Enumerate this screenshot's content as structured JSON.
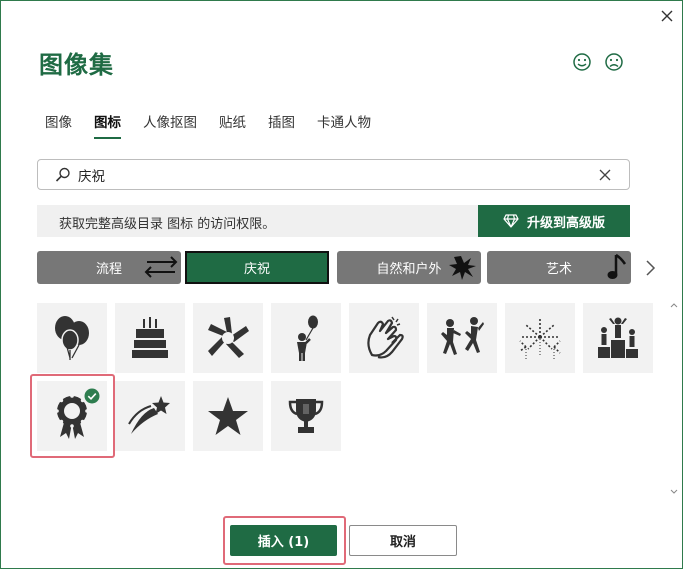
{
  "dialog": {
    "title": "图像集",
    "close_icon": "close-icon",
    "feedback": {
      "happy_icon": "smile-icon",
      "sad_icon": "frown-icon"
    }
  },
  "tabs": [
    {
      "label": "图像",
      "active": false
    },
    {
      "label": "图标",
      "active": true
    },
    {
      "label": "人像抠图",
      "active": false
    },
    {
      "label": "贴纸",
      "active": false
    },
    {
      "label": "插图",
      "active": false
    },
    {
      "label": "卡通人物",
      "active": false
    }
  ],
  "search": {
    "value": "庆祝",
    "icon": "search-icon",
    "clear_icon": "clear-icon"
  },
  "promo": {
    "text": "获取完整高级目录 图标 的访问权限。",
    "upgrade_label": "升级到高级版",
    "upgrade_icon": "diamond-icon"
  },
  "categories": [
    {
      "label": "流程",
      "active": false,
      "icon": "swap-arrows-icon"
    },
    {
      "label": "庆祝",
      "active": true,
      "icon": ""
    },
    {
      "label": "自然和户外",
      "active": false,
      "icon": "splat-icon"
    },
    {
      "label": "艺术",
      "active": false,
      "icon": "music-note-icon"
    }
  ],
  "icons": [
    {
      "name": "balloons-icon",
      "selected": false
    },
    {
      "name": "birthday-cake-icon",
      "selected": false
    },
    {
      "name": "hands-together-icon",
      "selected": false
    },
    {
      "name": "person-balloon-icon",
      "selected": false
    },
    {
      "name": "clapping-hands-icon",
      "selected": false
    },
    {
      "name": "dancing-people-icon",
      "selected": false
    },
    {
      "name": "fireworks-icon",
      "selected": false
    },
    {
      "name": "podium-icon",
      "selected": false
    },
    {
      "name": "award-ribbon-icon",
      "selected": true
    },
    {
      "name": "shooting-star-icon",
      "selected": false
    },
    {
      "name": "star-icon",
      "selected": false
    },
    {
      "name": "trophy-icon",
      "selected": false
    }
  ],
  "footer": {
    "insert_label": "插入 (1)",
    "cancel_label": "取消"
  },
  "colors": {
    "accent": "#1f6b44",
    "highlight": "#e06a78",
    "category_bg": "#777777",
    "tile_bg": "#f2f2f2",
    "icon_fill": "#333333",
    "badge": "#2e7d4f"
  }
}
